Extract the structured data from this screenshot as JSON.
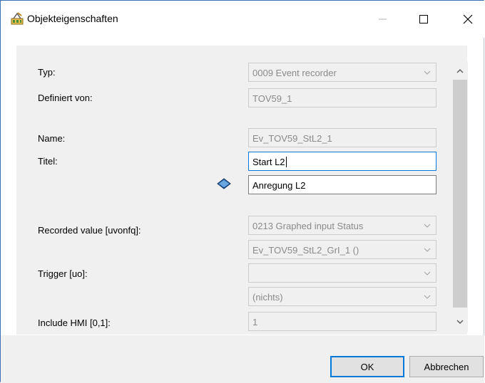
{
  "window": {
    "title": "Objekteigenschaften"
  },
  "titlebar": {
    "minimize_icon": "minimize-icon",
    "maximize_icon": "maximize-icon",
    "close_icon": "close-icon"
  },
  "form": {
    "typ": {
      "label": "Typ:",
      "value": "0009  Event recorder"
    },
    "definiert_von": {
      "label": "Definiert von:",
      "value": "TOV59_1"
    },
    "name": {
      "label": "Name:",
      "value": "Ev_TOV59_StL2_1"
    },
    "titel": {
      "label": "Titel:",
      "value": "Start L2",
      "value2": "Anregung L2"
    },
    "recorded_value": {
      "label": "Recorded value [uvonfq]:",
      "value": "0213  Graphed input Status",
      "value2": "Ev_TOV59_StL2_GrI_1 ()"
    },
    "trigger": {
      "label": "Trigger [uo]:",
      "value": "",
      "value2": "(nichts)"
    },
    "include_hmi": {
      "label": "Include HMI [0,1]:",
      "value": "1"
    }
  },
  "buttons": {
    "ok": "OK",
    "cancel": "Abbrechen"
  },
  "icons": {
    "app": "properties-icon",
    "language_book": "book-icon",
    "dropdown": "chevron-down-icon"
  },
  "colors": {
    "accent": "#0078d7",
    "panel_bg": "#f0f0f0",
    "disabled_text": "#8a8a8a"
  }
}
